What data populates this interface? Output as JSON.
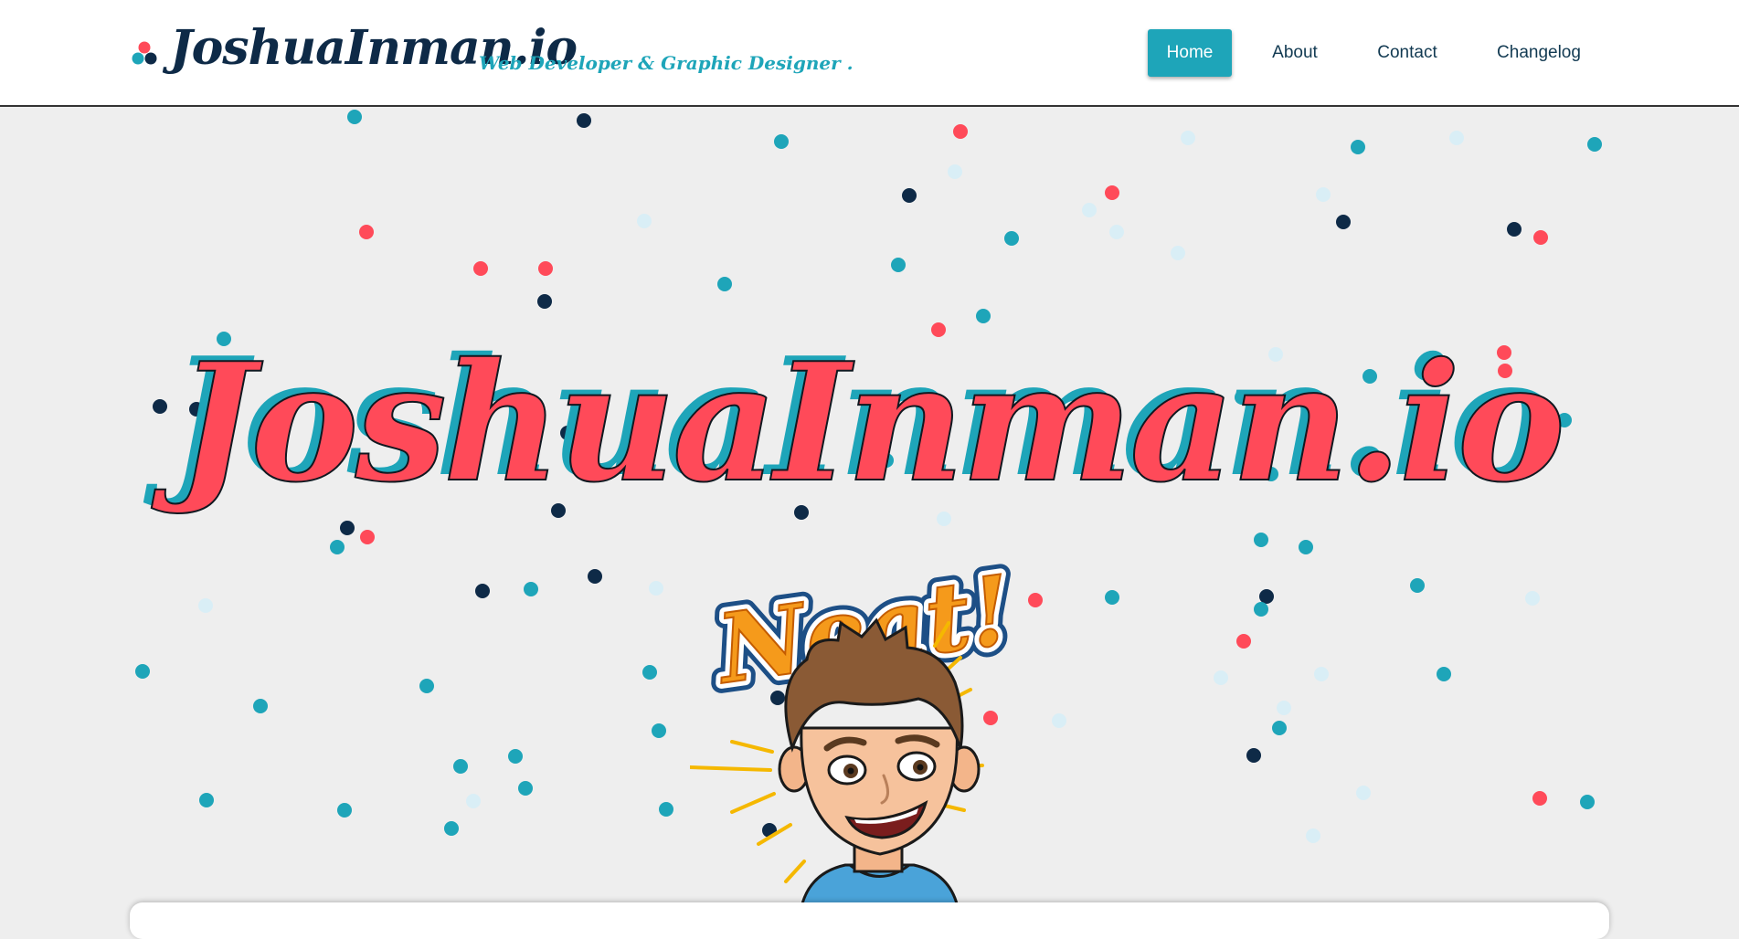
{
  "header": {
    "brand": "JoshuaInman.io",
    "tagline": "Web Developer & Graphic Designer .",
    "logo_icon": "three-dots-logo-icon",
    "nav": [
      {
        "label": "Home",
        "active": true
      },
      {
        "label": "About",
        "active": false
      },
      {
        "label": "Contact",
        "active": false
      },
      {
        "label": "Changelog",
        "active": false
      }
    ]
  },
  "hero": {
    "title": "JoshuaInman.io",
    "sticker_text": "Neat!",
    "avatar_icon": "cartoon-avatar-icon"
  },
  "colors": {
    "accent": "#1ea5b9",
    "red": "#ff4a59",
    "navy": "#0e2a47",
    "pale": "#d9eef6",
    "background": "#eeeeee"
  }
}
